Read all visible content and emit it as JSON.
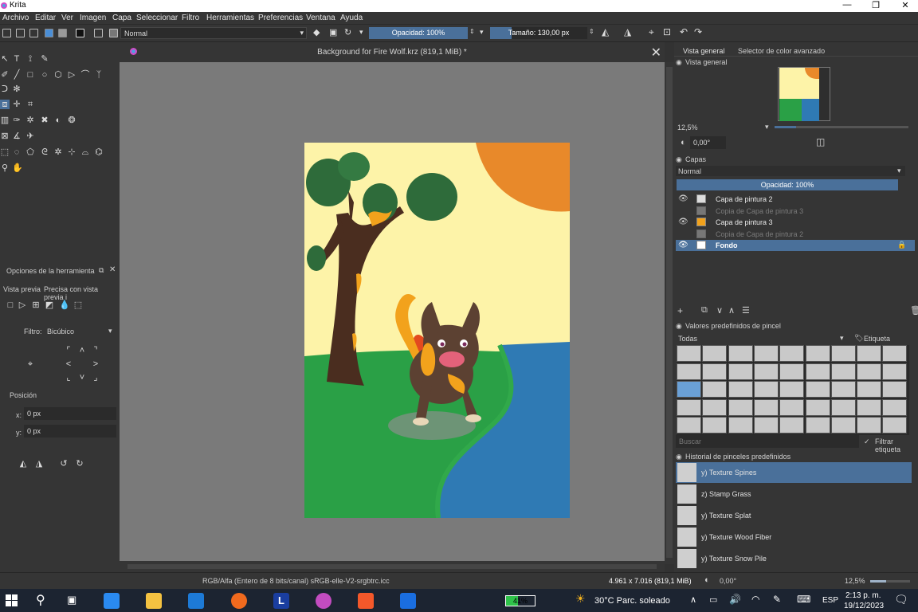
{
  "app": {
    "title": "Krita"
  },
  "menu": [
    "Archivo",
    "Editar",
    "Ver",
    "Imagen",
    "Capa",
    "Seleccionar",
    "Filtro",
    "Herramientas",
    "Preferencias",
    "Ventana",
    "Ayuda"
  ],
  "toolbar": {
    "blend_mode": "Normal",
    "opacity_label": "Opacidad: 100%",
    "opacity_value": 1.0,
    "size_label": "Tamaño: 130,00 px",
    "size_value": 0.22
  },
  "document": {
    "tab_title": "Background for Fire Wolf.krz (819,1 MiB) *"
  },
  "tool_options": {
    "title": "Opciones de la herramienta",
    "preview_label": "Vista previa",
    "precise_label": "Precisa con vista previa i",
    "filter_label": "Filtro:",
    "filter_value": "Bicúbico",
    "position_label": "Posición",
    "x_label": "x:",
    "x_value": "0 px",
    "y_label": "y:",
    "y_value": "0 px"
  },
  "overview": {
    "tab1": "Vista general",
    "tab2": "Selector de color avanzado",
    "title": "Vista general",
    "zoom": "12,5%",
    "rotation": "0,00°",
    "zoom_value": 0.4
  },
  "layers": {
    "title": "Capas",
    "blend": "Normal",
    "opacity": "Opacidad: 100%",
    "opacity_value": 1.0,
    "items": [
      {
        "name": "Capa de pintura 2",
        "visible": true,
        "active": false
      },
      {
        "name": "Copia de Capa de pintura 3",
        "visible": false,
        "active": false
      },
      {
        "name": "Capa de pintura 3",
        "visible": true,
        "active": false
      },
      {
        "name": "Copia de Capa de pintura 2",
        "visible": false,
        "active": false
      },
      {
        "name": "Fondo",
        "visible": true,
        "active": true
      }
    ]
  },
  "brush_presets": {
    "title": "Valores predefinidos de pincel",
    "filter": "Todas",
    "tag": "Etiqueta",
    "search_placeholder": "Buscar",
    "filter_tag": "Filtrar etiqueta"
  },
  "history": {
    "title": "Historial de pinceles predefinidos",
    "items": [
      "y) Texture Spines",
      "z) Stamp Grass",
      "y) Texture Splat",
      "y) Texture Wood Fiber",
      "y) Texture Snow Pile"
    ]
  },
  "status": {
    "color_space": "RGB/Alfa (Entero de 8 bits/canal)  sRGB-elle-V2-srgbtrc.icc",
    "dimensions": "4.961 x 7.016 (819,1 MiB)",
    "rotation": "0,00°",
    "zoom": "12,5%",
    "zoom_value": 0.4
  },
  "taskbar": {
    "battery": "41%",
    "battery_value": 0.41,
    "weather": "30°C  Parc. soleado",
    "lang": "ESP",
    "time": "2:13 p. m.",
    "date": "19/12/2023"
  }
}
